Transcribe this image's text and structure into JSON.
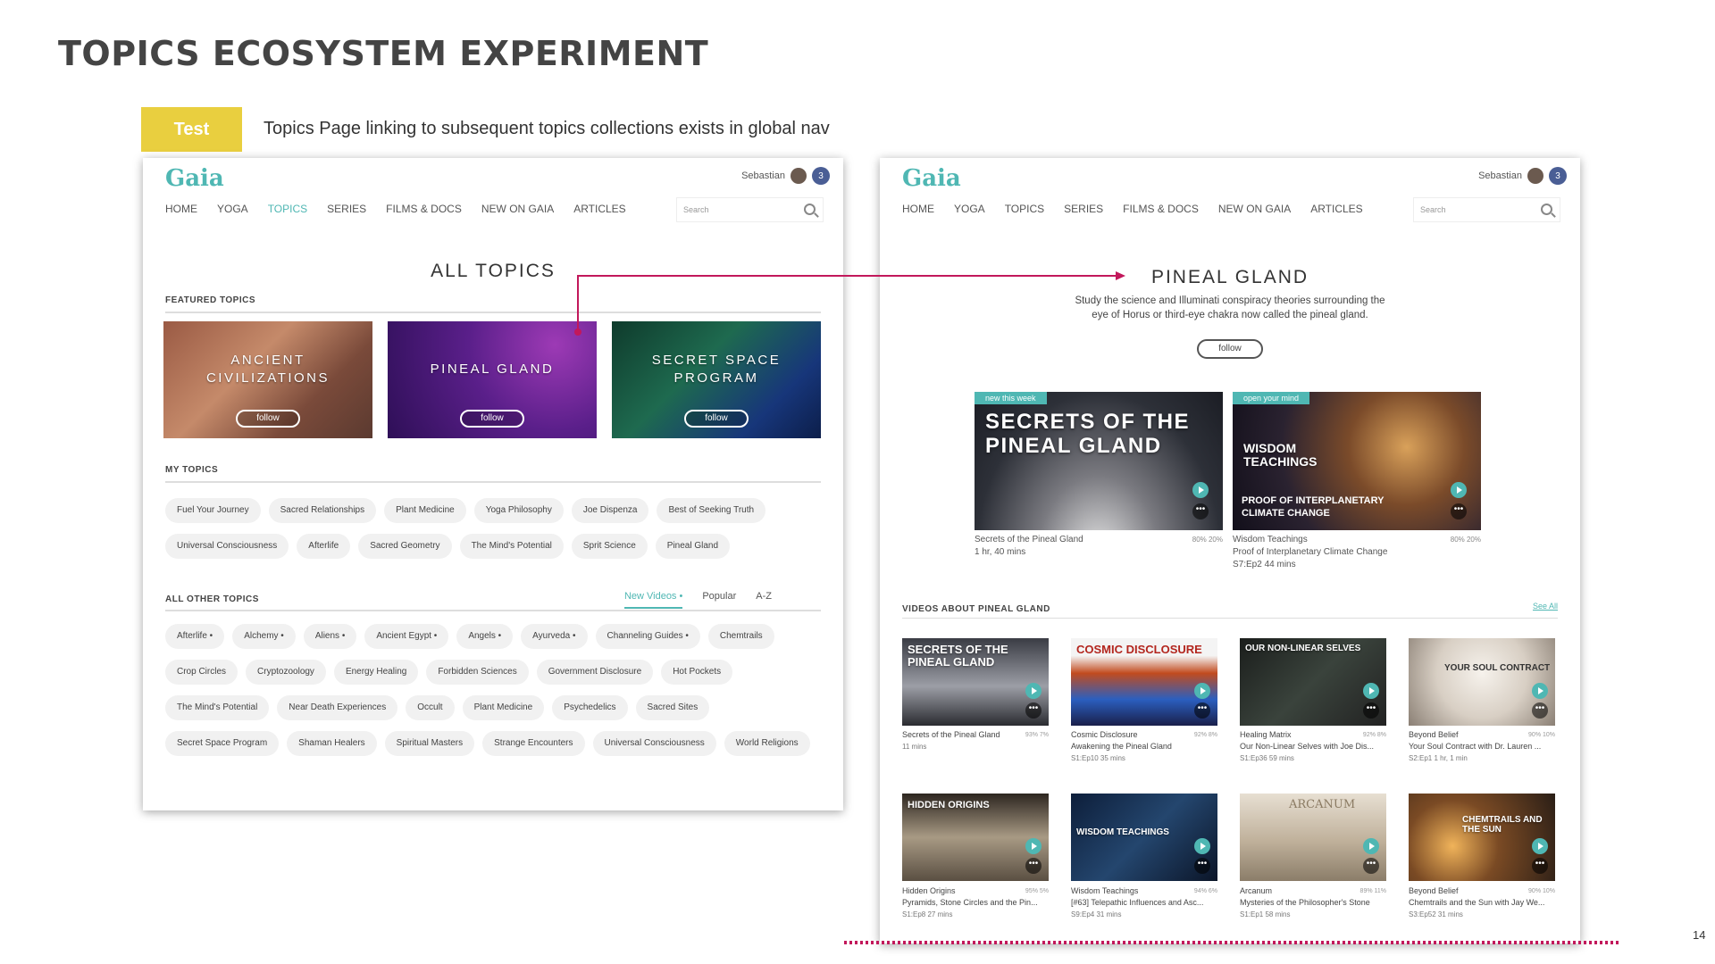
{
  "slide": {
    "title": "TOPICS ECOSYSTEM EXPERIMENT",
    "badge": "Test",
    "description": "Topics Page linking to subsequent topics collections exists in global nav",
    "page_number": "14"
  },
  "gaia": {
    "logo": "Gaia",
    "user_name": "Sebastian",
    "notification_count": "3",
    "nav": [
      "HOME",
      "YOGA",
      "TOPICS",
      "SERIES",
      "FILMS & DOCS",
      "NEW ON GAIA",
      "ARTICLES"
    ],
    "search_placeholder": "Search"
  },
  "left": {
    "title": "ALL TOPICS",
    "featured_label": "FEATURED TOPICS",
    "featured": [
      {
        "title_line1": "ANCIENT",
        "title_line2": "CIVILIZATIONS",
        "follow": "follow"
      },
      {
        "title_line1": "PINEAL GLAND",
        "title_line2": "",
        "follow": "follow"
      },
      {
        "title_line1": "SECRET SPACE",
        "title_line2": "PROGRAM",
        "follow": "follow"
      }
    ],
    "my_topics_label": "MY TOPICS",
    "my_topics": [
      "Fuel Your Journey",
      "Sacred Relationships",
      "Plant Medicine",
      "Yoga Philosophy",
      "Joe Dispenza",
      "Best of Seeking Truth",
      "Universal Consciousness",
      "Afterlife",
      "Sacred Geometry",
      "The Mind's Potential",
      "Sprit Science",
      "Pineal Gland"
    ],
    "other_label": "ALL OTHER TOPICS",
    "sort_tabs": [
      "New Videos •",
      "Popular",
      "A-Z"
    ],
    "other_topics": [
      "Afterlife •",
      "Alchemy •",
      "Aliens •",
      "Ancient Egypt •",
      "Angels •",
      "Ayurveda •",
      "Channeling Guides •",
      "Chemtrails",
      "Crop Circles",
      "Cryptozoology",
      "Energy Healing",
      "Forbidden Sciences",
      "Government Disclosure",
      "Hot Pockets",
      "The Mind's Potential",
      "Near Death Experiences",
      "Occult",
      "Plant Medicine",
      "Psychedelics",
      "Sacred Sites",
      "Secret Space Program",
      "Shaman Healers",
      "Spiritual Masters",
      "Strange Encounters",
      "Universal Consciousness",
      "World Religions"
    ]
  },
  "right": {
    "title": "PINEAL GLAND",
    "description": "Study the science and Illuminati conspiracy theories surrounding the eye of Horus or third-eye chakra now called the pineal gland.",
    "follow": "follow",
    "heroes": [
      {
        "tag": "new this week",
        "title_line1": "SECRETS OF THE",
        "title_line2": "PINEAL GLAND",
        "sub_line1": "",
        "sub_line2": "",
        "series": "Secrets of the Pineal Gland",
        "name": "",
        "duration": "1 hr, 40 mins",
        "stats": "80% 20%"
      },
      {
        "tag": "open your mind",
        "title_line1": "WISDOM",
        "title_line2": "TEACHINGS",
        "sub_line1": "PROOF OF INTERPLANETARY",
        "sub_line2": "CLIMATE CHANGE",
        "series": "Wisdom Teachings",
        "name": "Proof of Interplanetary Climate Change",
        "duration": "S7:Ep2   44 mins",
        "stats": "80% 20%"
      }
    ],
    "videos_label": "VIDEOS ABOUT PINEAL GLAND",
    "see_all": "See All",
    "videos": [
      {
        "thumb": "SECRETS OF THE PINEAL GLAND",
        "series": "Secrets of the Pineal Gland",
        "title": "",
        "meta": "11 mins",
        "stats": "93% 7%"
      },
      {
        "thumb": "COSMIC DISCLOSURE",
        "series": "Cosmic Disclosure",
        "title": "Awakening the Pineal Gland",
        "meta": "S1:Ep10   35 mins",
        "stats": "92% 8%"
      },
      {
        "thumb": "OUR NON-LINEAR SELVES",
        "series": "Healing Matrix",
        "title": "Our Non-Linear Selves with Joe Dis...",
        "meta": "S1:Ep36   59 mins",
        "stats": "92% 8%"
      },
      {
        "thumb": "YOUR SOUL CONTRACT",
        "series": "Beyond Belief",
        "title": "Your Soul Contract with Dr. Lauren ...",
        "meta": "S2:Ep1   1 hr, 1 min",
        "stats": "90% 10%"
      },
      {
        "thumb": "HIDDEN ORIGINS",
        "series": "Hidden Origins",
        "title": "Pyramids, Stone Circles and the Pin...",
        "meta": "S1:Ep8   27 mins",
        "stats": "95% 5%"
      },
      {
        "thumb": "WISDOM TEACHINGS",
        "series": "Wisdom Teachings",
        "title": "[#63] Telepathic Influences and Asc...",
        "meta": "S9:Ep4   31 mins",
        "stats": "94% 6%"
      },
      {
        "thumb": "ARCANUM",
        "series": "Arcanum",
        "title": "Mysteries of the Philosopher's Stone",
        "meta": "S1:Ep1   58 mins",
        "stats": "89% 11%"
      },
      {
        "thumb": "CHEMTRAILS AND THE SUN",
        "series": "Beyond Belief",
        "title": "Chemtrails and the Sun with Jay We...",
        "meta": "S3:Ep52   31 mins",
        "stats": "90% 10%"
      }
    ]
  },
  "colors": {
    "accent": "#4fb7b3",
    "badge": "#e9cf3f",
    "link_arrow": "#c2185b"
  }
}
